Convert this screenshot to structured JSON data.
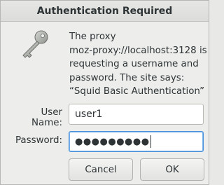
{
  "window": {
    "title": "Authentication Required"
  },
  "icon": {
    "name": "key-icon"
  },
  "message": {
    "lines": [
      "The proxy",
      "moz-proxy://localhost:3128 is",
      "requesting a username and",
      "password. The site says:",
      "“Squid Basic Authentication”"
    ]
  },
  "form": {
    "username_label": "User Name:",
    "username_value": "user1",
    "password_label": "Password:",
    "password_masked": "●●●●●●●●●"
  },
  "buttons": {
    "cancel_label": "Cancel",
    "ok_label": "OK"
  }
}
